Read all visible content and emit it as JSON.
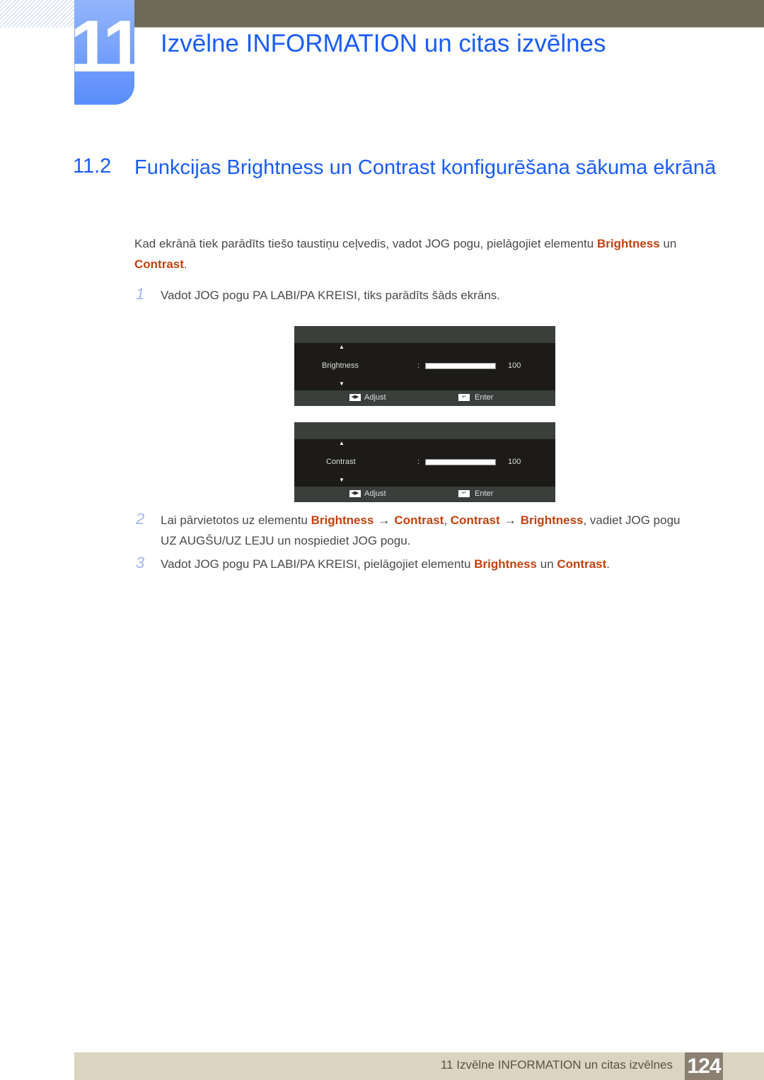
{
  "chapter": {
    "number": "11",
    "title": "Izvēlne INFORMATION un citas izvēlnes"
  },
  "section": {
    "number": "11.2",
    "title": "Funkcijas Brightness un Contrast konfigurēšana sākuma ekrānā"
  },
  "intro": {
    "text_before": "Kad ekrānā tiek parādīts tiešo taustiņu ceļvedis, vadot JOG pogu, pielāgojiet elementu ",
    "hl1": "Brightness",
    "mid": " un",
    "hl2": "Contrast",
    "end": "."
  },
  "steps": [
    {
      "num": "1",
      "text": "Vadot JOG pogu PA LABI/PA KREISI, tiks parādīts šāds ekrāns."
    },
    {
      "num": "2",
      "t1": "Lai pārvietotos uz elementu ",
      "h1": "Brightness",
      "arrow": "→",
      "h2": "Contrast",
      "sep": ", ",
      "h3": "Contrast",
      "h4": "Brightness",
      "t2": ", vadiet JOG pogu",
      "t3": "UZ AUGŠU/UZ LEJU un nospiediet JOG pogu."
    },
    {
      "num": "3",
      "t1": "Vadot JOG pogu PA LABI/PA KREISI, pielāgojiet elementu ",
      "h1": "Brightness",
      "mid": " un ",
      "h2": "Contrast",
      "end": "."
    }
  ],
  "osd": [
    {
      "label": "Brightness",
      "colon": ":",
      "value": "100",
      "level_percent": 100,
      "up": "▲",
      "down": "▼",
      "adjust_icon": "◀▶",
      "adjust_label": "Adjust",
      "enter_icon": "↵",
      "enter_label": "Enter"
    },
    {
      "label": "Contrast",
      "colon": ":",
      "value": "100",
      "level_percent": 100,
      "up": "▲",
      "down": "▼",
      "adjust_icon": "◀▶",
      "adjust_label": "Adjust",
      "enter_icon": "↵",
      "enter_label": "Enter"
    }
  ],
  "footer": {
    "text": "11 Izvēlne INFORMATION un citas izvēlnes",
    "page": "124"
  },
  "colors": {
    "heading_blue": "#1a5cf7",
    "highlight": "#c4410f",
    "topbar": "#6d6a58",
    "footer_bg": "#dad4c0",
    "page_box": "#8c8072"
  }
}
